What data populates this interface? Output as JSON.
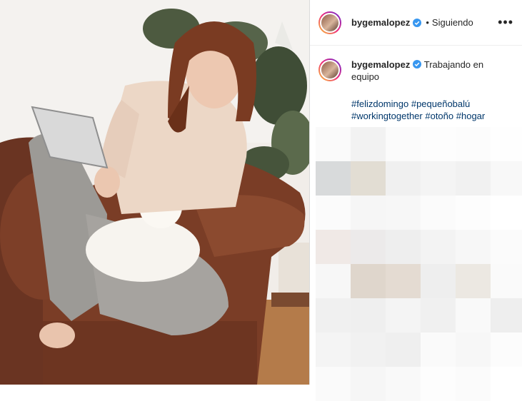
{
  "header": {
    "username": "bygemalopez",
    "separator": "•",
    "follow_status": "Siguiendo",
    "more_label": "•••"
  },
  "caption": {
    "username": "bygemalopez",
    "text": "Trabajando en equipo",
    "hashtags": [
      "#felizdomingo",
      "#pequeñobalú",
      "#workingtogether",
      "#otoño",
      "#hogar"
    ]
  },
  "colors": {
    "link": "#00376b",
    "verified": "#3897f0",
    "divider": "#dbdbdb"
  },
  "icons": {
    "verified": "verified-badge-icon",
    "more": "more-options-icon"
  }
}
